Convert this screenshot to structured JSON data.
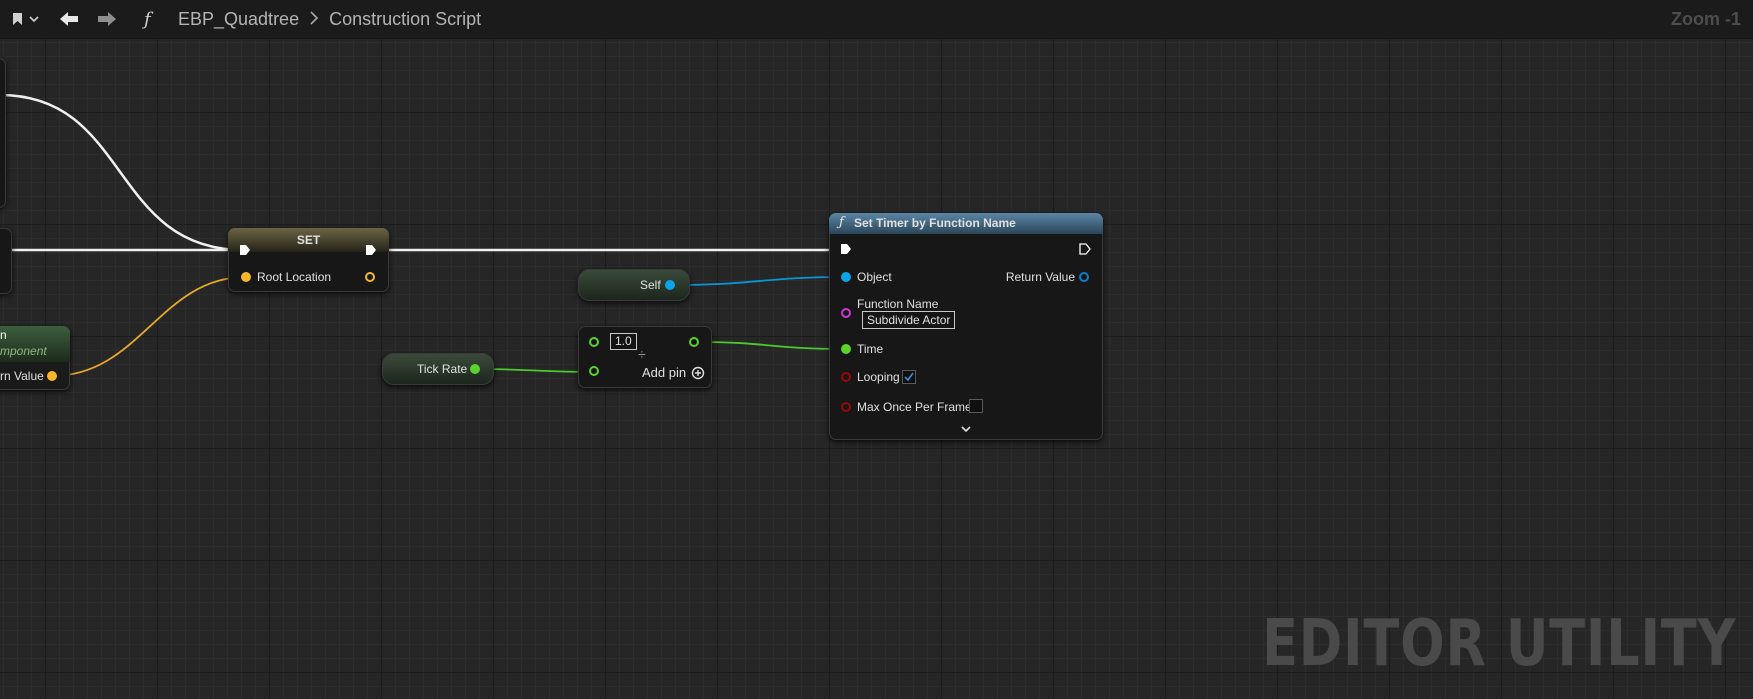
{
  "toolbar": {
    "breadcrumb_blueprint": "EBP_Quadtree",
    "breadcrumb_graph": "Construction Script",
    "zoom": "Zoom -1"
  },
  "nodes": {
    "set": {
      "title": "SET",
      "input_label": "Root Location"
    },
    "left_partial": {
      "title_fragment": "n",
      "subtitle_fragment": "mponent",
      "output_label": "rn Value"
    },
    "self": {
      "label": "Self"
    },
    "tick_rate": {
      "label": "Tick Rate"
    },
    "divide": {
      "input_value": "1.0",
      "operator": "÷",
      "add_pin_label": "Add pin"
    },
    "set_timer": {
      "title": "Set Timer by Function Name",
      "object_label": "Object",
      "return_label": "Return Value",
      "function_name_label": "Function Name",
      "function_name_value": "Subdivide Actor",
      "time_label": "Time",
      "looping_label": "Looping",
      "looping_checked": true,
      "max_once_label": "Max Once Per Frame",
      "max_once_checked": false
    }
  },
  "watermark": "EDITOR UTILITY",
  "colors": {
    "exec_wire": "#ffffff",
    "vector_pin": "#f5b82a",
    "object_pin": "#0aa5e8",
    "float_pin": "#5ad32e",
    "name_pin": "#c83ad0",
    "bool_pin": "#930a0a",
    "function_header": "#4b7390"
  }
}
